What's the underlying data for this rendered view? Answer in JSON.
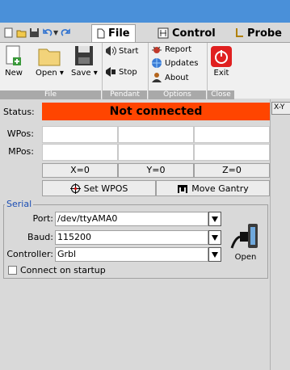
{
  "ribbon_tabs": [
    {
      "label": "File",
      "active": true,
      "icon": "file-icon"
    },
    {
      "label": "Control",
      "active": false,
      "icon": "control-icon"
    },
    {
      "label": "Probe",
      "active": false,
      "icon": "probe-icon"
    }
  ],
  "ribbon": {
    "file_group": {
      "label": "File",
      "new": "New",
      "open": "Open",
      "save": "Save"
    },
    "pendant_group": {
      "label": "Pendant",
      "start": "Start",
      "stop": "Stop"
    },
    "options_group": {
      "label": "Options",
      "report": "Report",
      "updates": "Updates",
      "about": "About"
    },
    "close_group": {
      "label": "Close",
      "exit": "Exit"
    }
  },
  "side_tab": {
    "label": "X-Y"
  },
  "status": {
    "label": "Status:",
    "value": "Not connected",
    "color": "#ff4500"
  },
  "positions": {
    "wpos_label": "WPos:",
    "mpos_label": "MPos:",
    "zero_buttons": [
      "X=0",
      "Y=0",
      "Z=0"
    ],
    "set_wpos": "Set WPOS",
    "move_gantry": "Move Gantry"
  },
  "serial": {
    "title": "Serial",
    "port_label": "Port:",
    "port_value": "/dev/ttyAMA0",
    "baud_label": "Baud:",
    "baud_value": "115200",
    "controller_label": "Controller:",
    "controller_value": "Grbl",
    "open_label": "Open",
    "connect_label": "Connect on startup",
    "connect_checked": false
  }
}
